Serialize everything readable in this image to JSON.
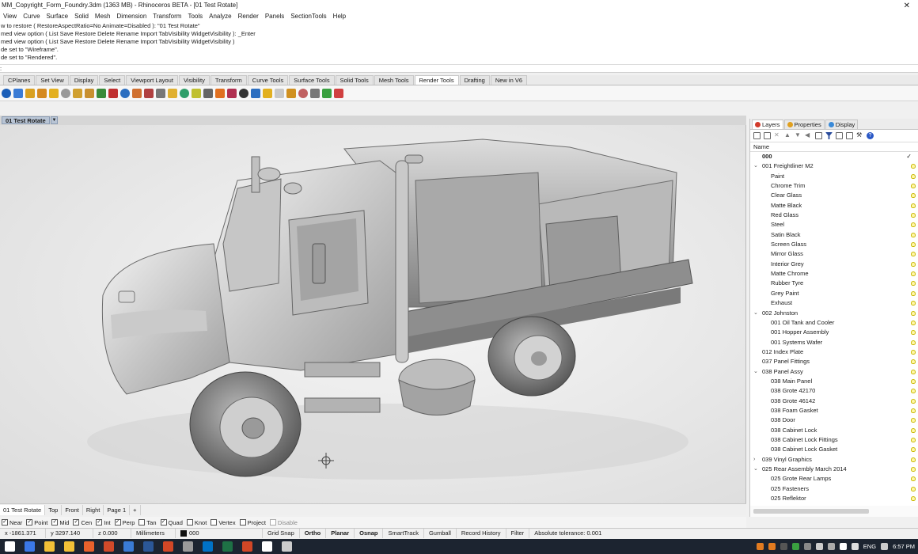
{
  "window": {
    "title": "MM_Copyright_Form_Foundry.3dm (1363 MB) - Rhinoceros BETA - [01 Test Rotate]"
  },
  "menu": [
    "View",
    "Curve",
    "Surface",
    "Solid",
    "Mesh",
    "Dimension",
    "Transform",
    "Tools",
    "Analyze",
    "Render",
    "Panels",
    "SectionTools",
    "Help"
  ],
  "command_history": [
    "w to restore ( RestoreAspectRatio=No  Animate=Disabled ): \"01 Test Rotate\"",
    "med view option ( List  Save  Restore  Delete  Rename  Import  TabVisibility  WidgetVisibility ): _Enter",
    "med view option ( List  Save  Restore  Delete  Rename  Import  TabVisibility  WidgetVisibility )",
    "de set to \"Wireframe\".",
    "de set to \"Rendered\"."
  ],
  "command_prompt": ":",
  "toolbar_tabs": [
    "CPlanes",
    "Set View",
    "Display",
    "Select",
    "Viewport Layout",
    "Visibility",
    "Transform",
    "Curve Tools",
    "Surface Tools",
    "Solid Tools",
    "Mesh Tools",
    "Render Tools",
    "Drafting",
    "New in V6"
  ],
  "toolbar_active_tab": "Render Tools",
  "toolbar_icon_colors": [
    "#1c5fb8",
    "#3a7bd5",
    "#d9a020",
    "#d58a20",
    "#e3b020",
    "#999999",
    "#d0a030",
    "#c89030",
    "#3a8a3a",
    "#c03030",
    "#2d6fc0",
    "#d07030",
    "#b04040",
    "#777777",
    "#e0b030",
    "#2f9e6a",
    "#c0c030",
    "#666666",
    "#e07020",
    "#b03050",
    "#333333",
    "#2d6fc0",
    "#e2b020",
    "#c8c8c8",
    "#d09020",
    "#c06060",
    "#777777",
    "#3aa040",
    "#d04040"
  ],
  "viewport": {
    "name": "01 Test Rotate"
  },
  "viewport_tabs": [
    "01 Test Rotate",
    "Top",
    "Front",
    "Right",
    "Page 1",
    "+"
  ],
  "osnaps": [
    {
      "label": "Near",
      "checked": true
    },
    {
      "label": "Point",
      "checked": true
    },
    {
      "label": "Mid",
      "checked": true
    },
    {
      "label": "Cen",
      "checked": true
    },
    {
      "label": "Int",
      "checked": true
    },
    {
      "label": "Perp",
      "checked": true
    },
    {
      "label": "Tan",
      "checked": false
    },
    {
      "label": "Quad",
      "checked": true
    },
    {
      "label": "Knot",
      "checked": false
    },
    {
      "label": "Vertex",
      "checked": false
    },
    {
      "label": "Project",
      "checked": false
    },
    {
      "label": "Disable",
      "checked": false,
      "disabled": true
    }
  ],
  "status": {
    "x": "x -1861.371",
    "y": "y 3297.140",
    "z": "z 0.000",
    "units": "Millimeters",
    "layer": "000",
    "grid_snap": "Grid Snap",
    "ortho": "Ortho",
    "planar": "Planar",
    "osnap": "Osnap",
    "smarttrack": "SmartTrack",
    "gumball": "Gumball",
    "record_history": "Record History",
    "filter": "Filter",
    "tolerance": "Absolute tolerance: 0.001"
  },
  "panel": {
    "tabs": [
      "Layers",
      "Properties",
      "Display"
    ],
    "column_header": "Name",
    "layers": [
      {
        "name": "000",
        "indent": 0,
        "bold": true,
        "current": true
      },
      {
        "name": "001 Freightliner M2",
        "indent": 0,
        "expanded": true
      },
      {
        "name": "Paint",
        "indent": 1
      },
      {
        "name": "Chrome Trim",
        "indent": 1
      },
      {
        "name": "Clear Glass",
        "indent": 1
      },
      {
        "name": "Matte Black",
        "indent": 1
      },
      {
        "name": "Red Glass",
        "indent": 1
      },
      {
        "name": "Steel",
        "indent": 1
      },
      {
        "name": "Satin Black",
        "indent": 1
      },
      {
        "name": "Screen Glass",
        "indent": 1
      },
      {
        "name": "Mirror Glass",
        "indent": 1
      },
      {
        "name": "Interior Grey",
        "indent": 1
      },
      {
        "name": "Matte Chrome",
        "indent": 1
      },
      {
        "name": "Rubber Tyre",
        "indent": 1
      },
      {
        "name": "Grey Paint",
        "indent": 1
      },
      {
        "name": "Exhaust",
        "indent": 1
      },
      {
        "name": "002 Johnston",
        "indent": 0,
        "expanded": true
      },
      {
        "name": "001 Oil Tank and Cooler",
        "indent": 1
      },
      {
        "name": "001 Hopper Assembly",
        "indent": 1
      },
      {
        "name": "001 Systems Wafer",
        "indent": 1
      },
      {
        "name": "012 Index Plate",
        "indent": 0
      },
      {
        "name": "037 Panel Fittings",
        "indent": 0
      },
      {
        "name": "038 Panel Assy",
        "indent": 0,
        "expanded": true
      },
      {
        "name": "038 Main Panel",
        "indent": 1
      },
      {
        "name": "038 Grote 42170",
        "indent": 1
      },
      {
        "name": "038 Grote 46142",
        "indent": 1
      },
      {
        "name": "038 Foam Gasket",
        "indent": 1
      },
      {
        "name": "038 Door",
        "indent": 1
      },
      {
        "name": "038 Cabinet Lock",
        "indent": 1
      },
      {
        "name": "038 Cabinet Lock Fittings",
        "indent": 1
      },
      {
        "name": "038 Cabinet Lock Gasket",
        "indent": 1
      },
      {
        "name": "039 Vinyl Graphics",
        "indent": 0,
        "collapsed": true
      },
      {
        "name": "025 Rear Assembly March 2014",
        "indent": 0,
        "expanded": true
      },
      {
        "name": "025 Grote Rear Lamps",
        "indent": 1
      },
      {
        "name": "025 Fasteners",
        "indent": 1
      },
      {
        "name": "025 Reflektor",
        "indent": 1
      }
    ]
  },
  "taskbar": {
    "icon_colors": [
      "#ffffff",
      "#3b78e7",
      "#f2c037",
      "#f2c037",
      "#e8612c",
      "#d04a2a",
      "#3a7bd5",
      "#2b5797",
      "#d24726",
      "#9a9a9a",
      "#0072c6",
      "#1e7145",
      "#d24726",
      "#ffffff",
      "#cccccc"
    ],
    "language": "ENG",
    "time": "6:57 PM"
  }
}
